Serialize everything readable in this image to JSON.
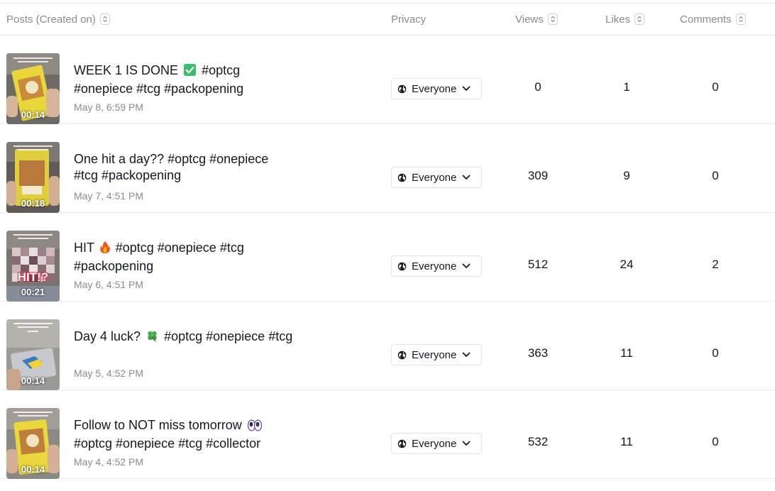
{
  "header": {
    "posts": "Posts (Created on)",
    "privacy": "Privacy",
    "views": "Views",
    "likes": "Likes",
    "comments": "Comments"
  },
  "colors": {
    "text": "#161823",
    "muted": "#8a8b91",
    "divider": "#ececee",
    "check": "#3bbf6c",
    "fire": "#f4511e",
    "clover": "#4caf50",
    "eyes": "#6b4fa0"
  },
  "posts": [
    {
      "title_before": "WEEK 1 IS DONE",
      "emoji": "check-mark-icon",
      "title_after": "#optcg #onepiece #tcg #packopening",
      "date": "May 8, 6:59 PM",
      "duration": "00:14",
      "privacy": "Everyone",
      "views": "0",
      "likes": "1",
      "comments": "0"
    },
    {
      "title_before": "One hit a day?? #optcg #onepiece #tcg #packopening",
      "emoji": "",
      "title_after": "",
      "date": "May 7, 4:51 PM",
      "duration": "00:18",
      "privacy": "Everyone",
      "views": "309",
      "likes": "9",
      "comments": "0"
    },
    {
      "title_before": "HIT",
      "emoji": "fire-icon",
      "title_after": "#optcg #onepiece #tcg #packopening",
      "date": "May 6, 4:51 PM",
      "duration": "00:21",
      "thumb_text": "HIT!?",
      "privacy": "Everyone",
      "views": "512",
      "likes": "24",
      "comments": "2"
    },
    {
      "title_before": "Day 4 luck?",
      "emoji": "four-leaf-clover-icon",
      "title_after": "#optcg #onepiece #tcg",
      "date": "May 5, 4:52 PM",
      "duration": "00:14",
      "privacy": "Everyone",
      "views": "363",
      "likes": "11",
      "comments": "0"
    },
    {
      "title_before": "Follow to NOT miss tomorrow",
      "emoji": "eyes-icon",
      "title_after": "#optcg #onepiece #tcg #collector",
      "date": "May 4, 4:52 PM",
      "duration": "00:14",
      "privacy": "Everyone",
      "views": "532",
      "likes": "11",
      "comments": "0"
    }
  ]
}
